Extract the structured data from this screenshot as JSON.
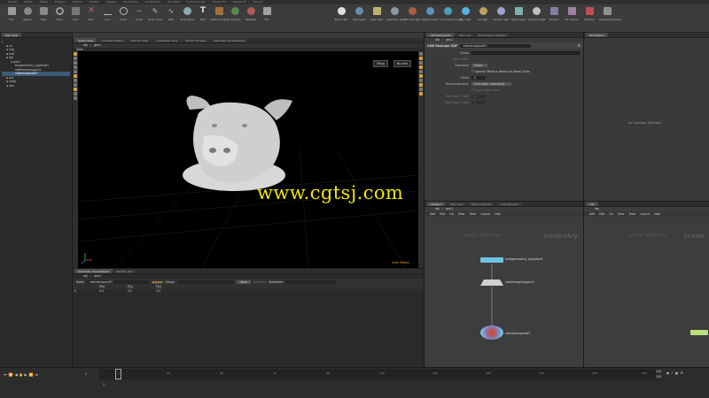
{
  "shelf": {
    "tabs": [
      "Create",
      "Modify",
      "Model",
      "Polygon",
      "Deform",
      "Texture",
      "Rigging",
      "Characters",
      "Constraints",
      "Hair Utils",
      "Guide Process",
      "Terrain FX",
      "Simple FX",
      "Volume"
    ],
    "tools": [
      "Box",
      "Sphere",
      "Tube",
      "Torus",
      "Grid",
      "Null",
      "Line",
      "Circle",
      "Curve",
      "Draw Curve",
      "Path",
      "Spray Paint",
      "Text",
      "Platonic Solids",
      "L-System",
      "Metaball",
      "File"
    ],
    "right_tools": [
      "Point Light",
      "Spot Light",
      "Area Light",
      "Geometry Light",
      "Volume Light",
      "Distant Light",
      "Environment Light",
      "Sky Light",
      "GI Light",
      "Caustic Light",
      "Portal Light",
      "Ambient Light",
      "Camera",
      "VR Camera",
      "Switcher",
      "Gamepad Camera"
    ]
  },
  "left_panel": {
    "tabs": [
      "Scene View",
      "Animation Editor",
      "Render View",
      "Composite View",
      "Motion FX View",
      "Geometry Spreadsheet"
    ],
    "tree_tab": "Tree View",
    "tree": [
      "/",
      "ch",
      "img",
      "mat",
      "obj",
      "geo1",
      "testgeometry_pighead1",
      "vdbfrompolygons1",
      "vdbreshapesdf1",
      "out",
      "shop",
      "vex"
    ],
    "selected_index": 8
  },
  "viewport": {
    "path": "obj",
    "node": "geo1",
    "title": "View",
    "persp_label": "Persp",
    "cam_label": "No cam",
    "edition": "Indie Edition"
  },
  "watermark": "www.cgtsj.com",
  "spreadsheet": {
    "tabs": [
      "Geometry Spreadsheet",
      "Render View"
    ],
    "node_label": "Node:",
    "node_value": "vdbreshapesdf1",
    "group_label": "Group:",
    "view_label": "View",
    "intrinsics_label": "Intrinsics",
    "attributes_label": "Attributes:",
    "columns": [
      "",
      "P[x]",
      "P[y]",
      "P[z]"
    ],
    "rows": [
      [
        "0",
        "0.0",
        "0.0",
        "0.0"
      ]
    ]
  },
  "params": {
    "tabs": [
      "vdbreshapesdf1",
      "Take List",
      "Performance Monitor"
    ],
    "path": "obj",
    "node": "geo1",
    "type_label": "VDB Reshape SDF",
    "name": "vdbreshapesdf1",
    "group_label": "Group",
    "alpha_label": "Alpha Mask",
    "operation_label": "Operation",
    "operation_value": "Erode",
    "offset_world_label": "Specify Offset in World (vs Voxel) Units",
    "offset_label": "Offset",
    "offset_value": "0",
    "renorm_label": "Renormalization",
    "renorm_value": "First-order upwinding",
    "invert_label": "Invert Alpha Mask",
    "min_cutoff_label": "Min Mask Cutoff",
    "max_cutoff_label": "Max Mask Cutoff",
    "min_cutoff_value": "0",
    "max_cutoff_value": "1"
  },
  "operator_panel": {
    "tab": "Parameters",
    "empty_text": "No Operator Selected"
  },
  "network": {
    "tabs": [
      "/obj/geo1",
      "Tree View",
      "Material Palette",
      "Asset Browser"
    ],
    "path": "obj",
    "node": "geo1",
    "menu": [
      "Add",
      "Edit",
      "Go",
      "View",
      "Tools",
      "Layout",
      "Help"
    ],
    "context_left": "Indie Edition",
    "context_right": "Geometry",
    "nodes": [
      "testgeometry_pighead1",
      "vdbfrompolygons1",
      "vdbreshapesdf1"
    ]
  },
  "network2": {
    "tabs": [
      "/obj"
    ],
    "path": "obj",
    "menu": [
      "Add",
      "Edit",
      "Go",
      "View",
      "Tools",
      "Layout",
      "Help"
    ],
    "context_left": "Indie Edition",
    "context_right": "Scene"
  },
  "timeline": {
    "current_frame": "1",
    "start": "1",
    "end": "240",
    "end2": "240",
    "ticks": [
      "1",
      "24",
      "48",
      "72",
      "96",
      "120",
      "144",
      "168",
      "192",
      "216",
      "240"
    ]
  },
  "colors": {
    "accent": "#d9a13a",
    "selection": "#3a5a7a",
    "watermark": "#f3e600"
  }
}
